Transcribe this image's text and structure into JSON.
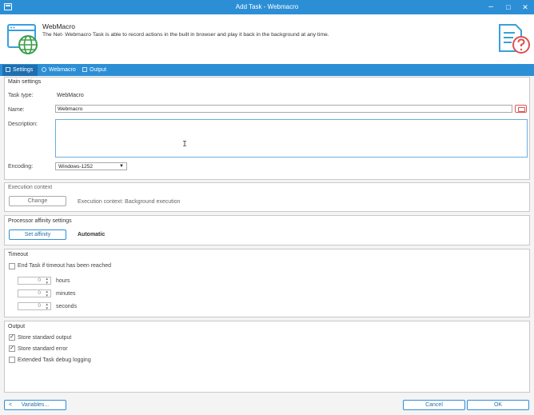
{
  "window": {
    "title": "Add Task - Webmacro",
    "controls": {
      "minimize": "–",
      "maximize": "□",
      "close": "✕"
    }
  },
  "header": {
    "title": "WebMacro",
    "description": "The Net- Webmacro Task is able to record actions in the built in browser and play it back in the background at any time."
  },
  "tabs": [
    {
      "label": "Settings",
      "active": true
    },
    {
      "label": "Webmacro",
      "active": false
    },
    {
      "label": "Output",
      "active": false
    }
  ],
  "main_settings": {
    "title": "Main settings",
    "task_type_label": "Task type:",
    "task_type_value": "WebMacro",
    "name_label": "Name:",
    "name_value": "Webmacro",
    "description_label": "Description:",
    "description_value": "",
    "encoding_label": "Encoding:",
    "encoding_value": "Windows-1252"
  },
  "execution_context": {
    "title": "Execution context",
    "change_label": "Change",
    "status": "Execution context: Background execution"
  },
  "processor_affinity": {
    "title": "Processor affinity settings",
    "button_label": "Set affinity",
    "value": "Automatic"
  },
  "timeout": {
    "title": "Timeout",
    "end_task_label": "End Task if timeout has been reached",
    "end_task_checked": false,
    "hours_value": "0",
    "hours_label": "hours",
    "minutes_value": "0",
    "minutes_label": "minutes",
    "seconds_value": "0",
    "seconds_label": "seconds"
  },
  "output": {
    "title": "Output",
    "store_output_label": "Store standard output",
    "store_output_checked": true,
    "store_error_label": "Store standard error",
    "store_error_checked": true,
    "debug_logging_label": "Extended Task debug logging",
    "debug_logging_checked": false
  },
  "footer": {
    "variables_label": "Variables...",
    "cancel_label": "Cancel",
    "ok_label": "OK"
  },
  "colors": {
    "accent": "#2c8fd6",
    "active_tab": "#1f6fb0",
    "icon_blue": "#3aa0dc",
    "icon_globe": "#3a9e4a",
    "icon_red": "#e05050"
  }
}
